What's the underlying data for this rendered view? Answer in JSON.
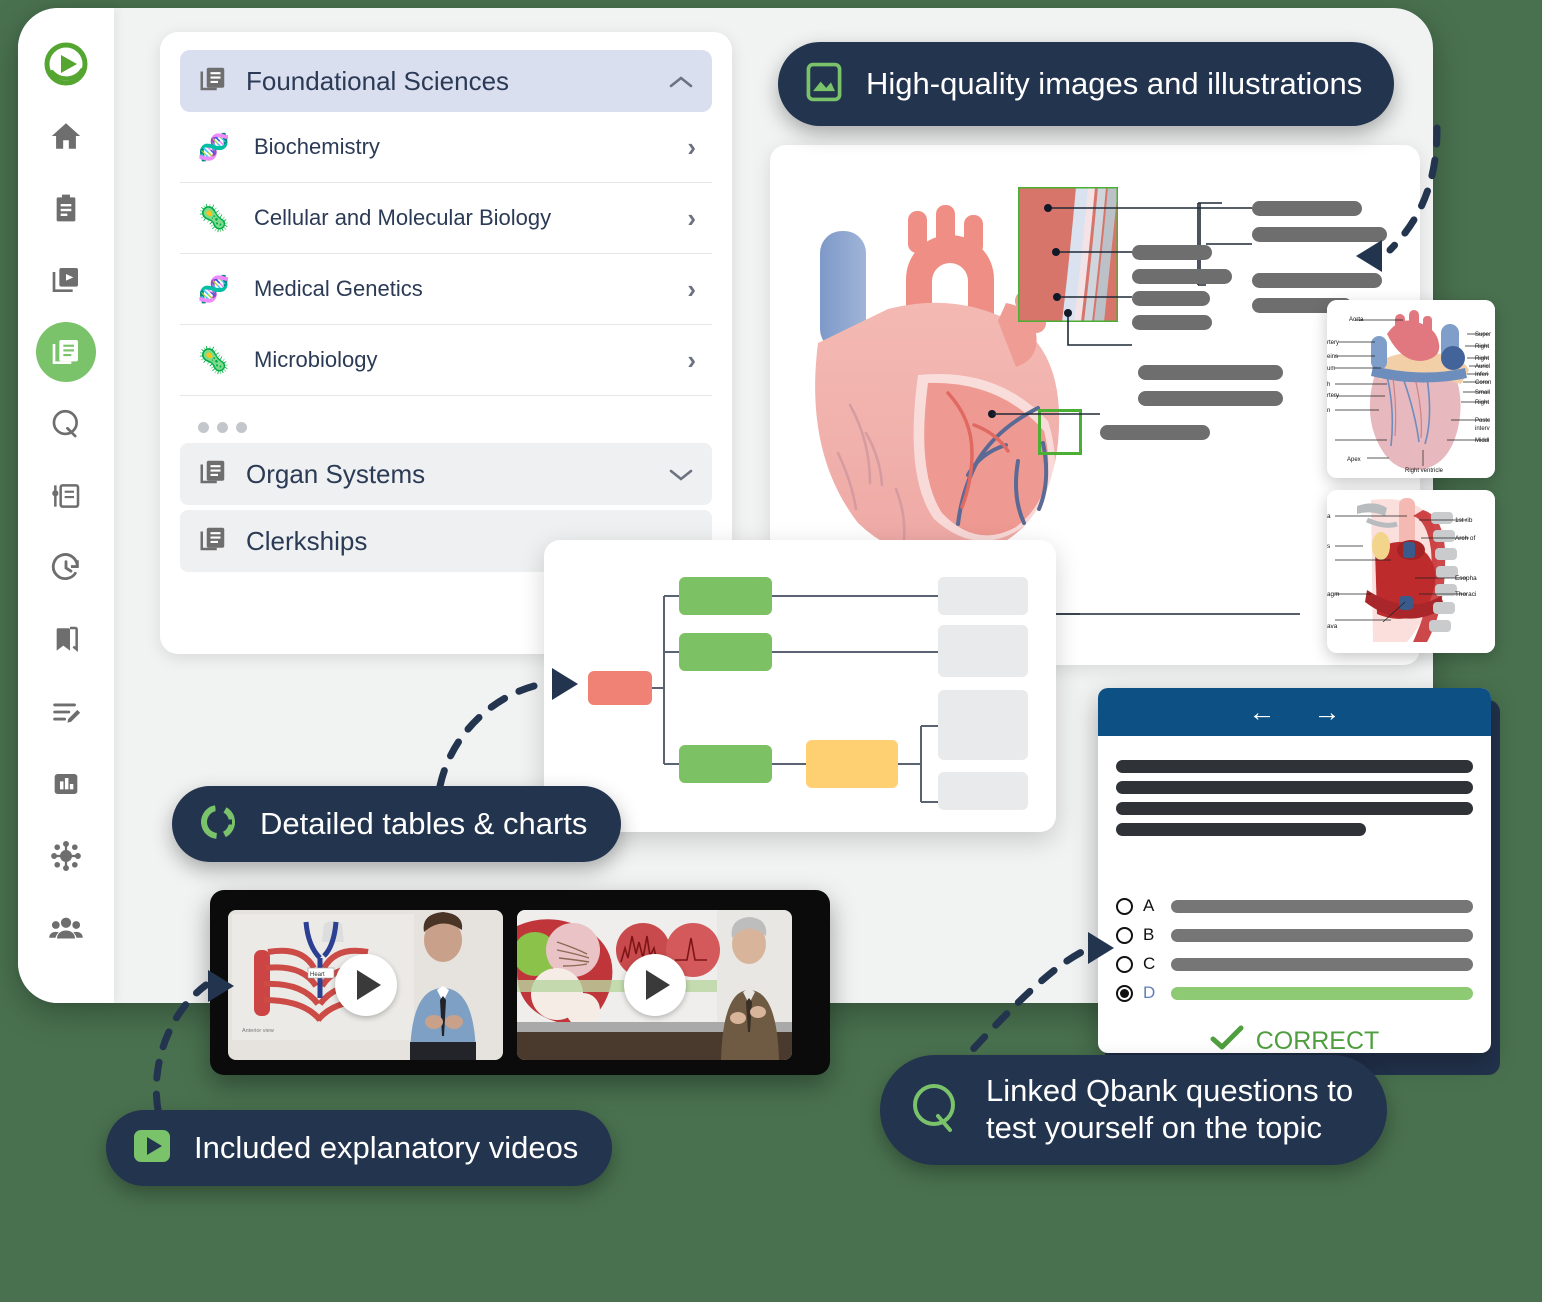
{
  "rail": {
    "items": [
      {
        "name": "logo-play-icon",
        "label": "Osmosis logo"
      },
      {
        "name": "home-icon",
        "label": "Home"
      },
      {
        "name": "clipboard-icon",
        "label": "Assignments"
      },
      {
        "name": "video-library-icon",
        "label": "Videos"
      },
      {
        "name": "notes-icon",
        "label": "Notes"
      },
      {
        "name": "qbank-q-icon",
        "label": "Qbank"
      },
      {
        "name": "flashcards-icon",
        "label": "Flashcards"
      },
      {
        "name": "history-clock-icon",
        "label": "Recent"
      },
      {
        "name": "bookmark-icon",
        "label": "Bookmarks"
      },
      {
        "name": "edit-list-icon",
        "label": "My notes"
      },
      {
        "name": "bar-chart-icon",
        "label": "Performance"
      },
      {
        "name": "molecule-icon",
        "label": "Pathways"
      },
      {
        "name": "people-icon",
        "label": "Groups"
      }
    ]
  },
  "nav": {
    "header": {
      "label": "Foundational Sciences",
      "icon": "library-icon",
      "chevron": "chevron-up-icon"
    },
    "items": [
      {
        "label": "Biochemistry",
        "emoji": "🧬",
        "chevron": "chevron-right-icon"
      },
      {
        "label": "Cellular and Molecular Biology",
        "emoji": "🦠",
        "chevron": "chevron-right-icon"
      },
      {
        "label": "Medical Genetics",
        "emoji": "🧬",
        "chevron": "chevron-right-icon"
      },
      {
        "label": "Microbiology",
        "emoji": "🦠",
        "chevron": "chevron-right-icon"
      }
    ],
    "overflow": "more-dots",
    "groups": [
      {
        "label": "Organ Systems",
        "icon": "library-icon",
        "chevron": "chevron-down-icon"
      },
      {
        "label": "Clerkships",
        "icon": "library-icon",
        "chevron": ""
      }
    ]
  },
  "badges": [
    {
      "id": "images",
      "icon": "image-icon",
      "text": "High-quality images and illustrations"
    },
    {
      "id": "charts",
      "icon": "donut-chart-icon",
      "text": "Detailed tables & charts"
    },
    {
      "id": "videos",
      "icon": "play-icon",
      "text": "Included explanatory videos"
    },
    {
      "id": "qbank",
      "icon": "q-icon",
      "line1": "Linked Qbank questions to",
      "line2": "test yourself on the topic"
    }
  ],
  "thumbnails": [
    {
      "name": "heart-posterior-diagram",
      "labels": [
        "Aorta",
        "rtery",
        "eins",
        "um",
        "h",
        "rtery",
        "n",
        "Apex",
        "Right ventricle",
        "Super",
        "Right",
        "Right",
        "Auricl",
        "Inferi",
        "Coron",
        "Small",
        "Right",
        "Poste",
        "interv",
        "Middl"
      ]
    },
    {
      "name": "thorax-cross-section-diagram",
      "labels": [
        "a",
        "s",
        "agm",
        "ava",
        "1st rib",
        "Arch of",
        "Esopha",
        "Thoraci"
      ]
    }
  ],
  "qbank": {
    "nav": {
      "prev": "←",
      "next": "→"
    },
    "options": [
      {
        "letter": "A",
        "selected": false,
        "correct": false
      },
      {
        "letter": "B",
        "selected": false,
        "correct": false
      },
      {
        "letter": "C",
        "selected": false,
        "correct": false
      },
      {
        "letter": "D",
        "selected": true,
        "correct": true
      }
    ],
    "result": {
      "label": "CORRECT",
      "icon": "check-icon",
      "color": "#4f9e3f"
    }
  },
  "videos": [
    {
      "name": "anatomy-lecture-video",
      "play": "play-icon"
    },
    {
      "name": "pathology-lecture-video",
      "play": "play-icon"
    }
  ],
  "colors": {
    "page_bg": "#49714f",
    "badge_bg": "#23344f",
    "accent_green": "#7ac36a",
    "nav_header_bg": "#dadff0",
    "qbank_header_bg": "#0d5184",
    "flow_red": "#ef8275",
    "flow_green": "#7cc163",
    "flow_amber": "#ffd071",
    "flow_grey": "#e8eaec"
  },
  "chart_data": {
    "type": "diagram",
    "title": "Detailed tables & charts",
    "nodes": [
      {
        "id": "root",
        "color": "#ef8275",
        "level": 0
      },
      {
        "id": "b1",
        "color": "#7cc163",
        "level": 1
      },
      {
        "id": "b2",
        "color": "#7cc163",
        "level": 1
      },
      {
        "id": "b3",
        "color": "#7cc163",
        "level": 1
      },
      {
        "id": "c1",
        "color": "#ffd071",
        "level": 2
      },
      {
        "id": "o1",
        "color": "#e8eaec",
        "level": 3
      },
      {
        "id": "o2",
        "color": "#e8eaec",
        "level": 3
      },
      {
        "id": "o3",
        "color": "#e8eaec",
        "level": 3
      },
      {
        "id": "o4",
        "color": "#e8eaec",
        "level": 3
      }
    ],
    "edges": [
      [
        "root",
        "b1"
      ],
      [
        "root",
        "b2"
      ],
      [
        "root",
        "b3"
      ],
      [
        "b1",
        "o1"
      ],
      [
        "b2",
        "o2"
      ],
      [
        "b3",
        "c1"
      ],
      [
        "c1",
        "o3"
      ],
      [
        "c1",
        "o4"
      ]
    ]
  }
}
